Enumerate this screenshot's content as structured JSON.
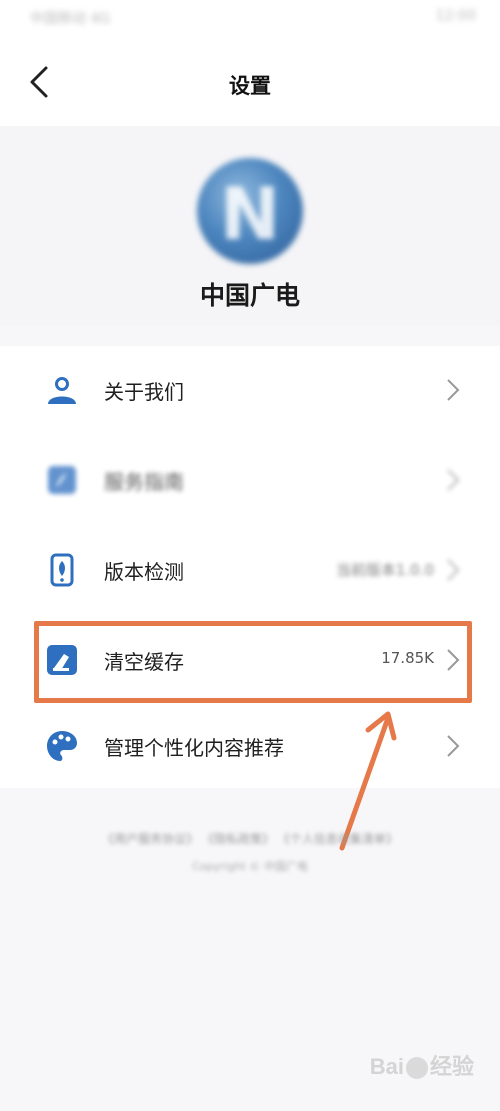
{
  "status_bar": {
    "left_text": "中国移动 4G",
    "right_text": "12:00"
  },
  "header": {
    "title": "设置",
    "back_icon": "chevron-left-icon"
  },
  "profile": {
    "logo_letter": "N",
    "name": "中国广电"
  },
  "menu": {
    "items": [
      {
        "label": "关于我们",
        "icon": "user-group-icon",
        "value": ""
      },
      {
        "label": "服务指南",
        "icon": "compass-icon",
        "value": ""
      },
      {
        "label": "版本检测",
        "icon": "rocket-phone-icon",
        "value": "当前版本1.0.0"
      },
      {
        "label": "清空缓存",
        "icon": "broom-icon",
        "value": "17.85K"
      },
      {
        "label": "管理个性化内容推荐",
        "icon": "palette-icon",
        "value": ""
      }
    ]
  },
  "footer": {
    "links": "《用户服务协议》 《隐私政策》 《个人信息收集清单》",
    "copyright": "Copyright © 中国广电"
  },
  "watermark": {
    "text": "Bai",
    "suffix": "经验"
  },
  "colors": {
    "accent_icon": "#2f6fbf",
    "highlight": "#e5794a"
  }
}
